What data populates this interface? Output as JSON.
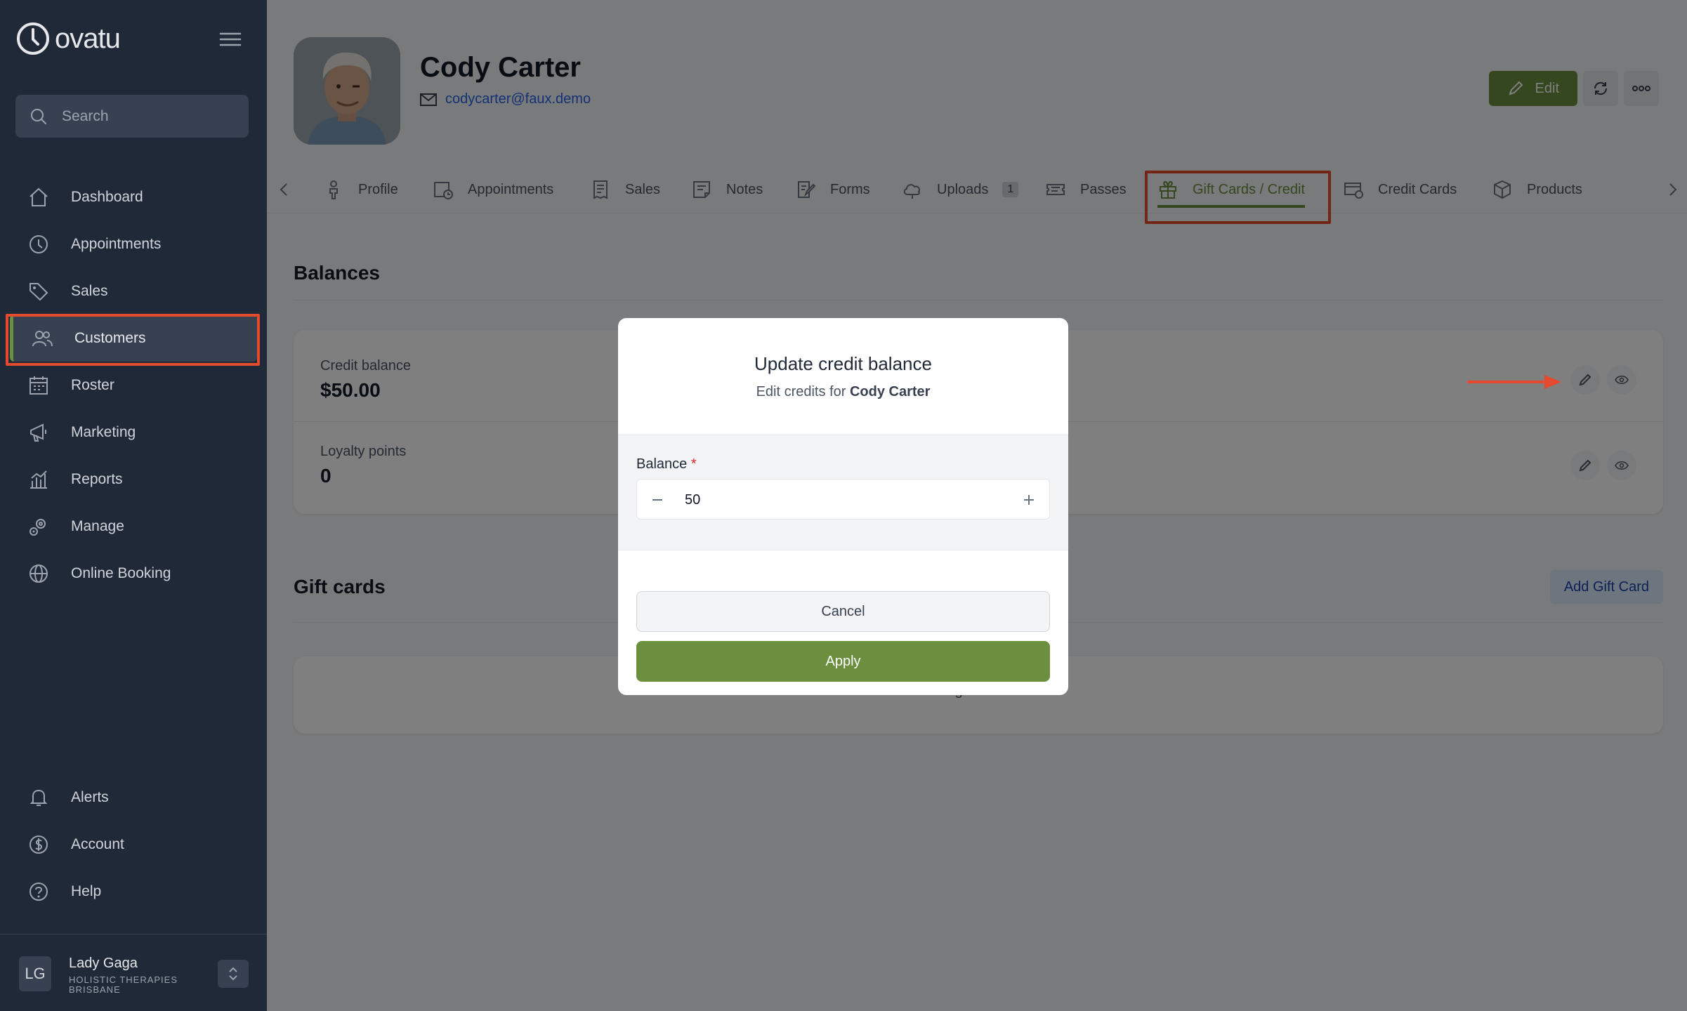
{
  "sidebar": {
    "logo_text": "ovatu",
    "search_placeholder": "Search",
    "nav": [
      {
        "label": "Dashboard",
        "icon": "home-icon"
      },
      {
        "label": "Appointments",
        "icon": "clock-icon"
      },
      {
        "label": "Sales",
        "icon": "tag-icon"
      },
      {
        "label": "Customers",
        "icon": "users-icon",
        "active": true
      },
      {
        "label": "Roster",
        "icon": "calendar-icon"
      },
      {
        "label": "Marketing",
        "icon": "megaphone-icon"
      },
      {
        "label": "Reports",
        "icon": "chart-icon"
      },
      {
        "label": "Manage",
        "icon": "gear-icon"
      },
      {
        "label": "Online Booking",
        "icon": "globe-icon"
      }
    ],
    "bottom_nav": [
      {
        "label": "Alerts",
        "icon": "bell-icon"
      },
      {
        "label": "Account",
        "icon": "dollar-icon"
      },
      {
        "label": "Help",
        "icon": "help-icon"
      }
    ],
    "user": {
      "initials": "LG",
      "name": "Lady Gaga",
      "business": "HOLISTIC THERAPIES BRISBANE"
    }
  },
  "customer": {
    "name": "Cody Carter",
    "email": "codycarter@faux.demo"
  },
  "header": {
    "edit_label": "Edit"
  },
  "tabs": [
    {
      "label": "Profile"
    },
    {
      "label": "Appointments"
    },
    {
      "label": "Sales"
    },
    {
      "label": "Notes"
    },
    {
      "label": "Forms"
    },
    {
      "label": "Uploads",
      "badge": "1"
    },
    {
      "label": "Passes"
    },
    {
      "label": "Gift Cards / Credit",
      "active": true
    },
    {
      "label": "Credit Cards"
    },
    {
      "label": "Products"
    }
  ],
  "balances": {
    "title": "Balances",
    "credit_label": "Credit balance",
    "credit_value": "$50.00",
    "loyalty_label": "Loyalty points",
    "loyalty_value": "0"
  },
  "gift_cards": {
    "title": "Gift cards",
    "add_label": "Add Gift Card",
    "empty_text": "No gift cards..."
  },
  "modal": {
    "title": "Update credit balance",
    "subtitle_prefix": "Edit credits for",
    "subtitle_name": "Cody Carter",
    "field_label": "Balance",
    "required_mark": "*",
    "value": "50",
    "cancel_label": "Cancel",
    "apply_label": "Apply"
  },
  "colors": {
    "accent": "#6b8f3e",
    "sidebar_bg": "#1f2937",
    "highlight": "#e64a2e"
  }
}
